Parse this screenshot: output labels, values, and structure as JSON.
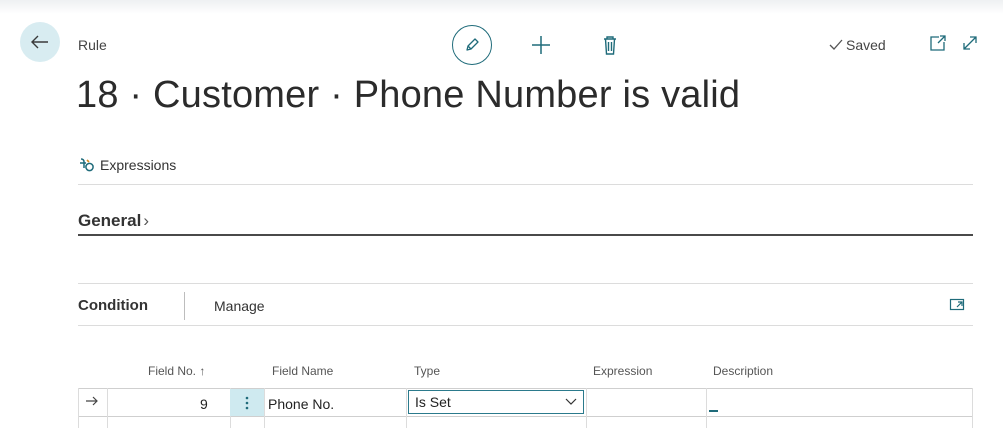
{
  "header": {
    "caption": "Rule",
    "saved_label": "Saved",
    "title": "18 · Customer · Phone Number is valid"
  },
  "actions": {
    "expressions_label": "Expressions"
  },
  "general": {
    "label": "General",
    "chevron": "›"
  },
  "condition": {
    "title": "Condition",
    "manage_label": "Manage",
    "columns": {
      "field_no": "Field No. ↑",
      "field_name": "Field Name",
      "type": "Type",
      "expression": "Expression",
      "description": "Description"
    },
    "rows": [
      {
        "field_no": "9",
        "field_name": "Phone No.",
        "type": "Is Set",
        "expression": "",
        "description": ""
      }
    ]
  },
  "colors": {
    "accent": "#1f6b7a",
    "back_button_bg": "#d8ecf1",
    "row_highlight": "#cfeaf0"
  },
  "icons": [
    "back-arrow-icon",
    "pencil-icon",
    "plus-icon",
    "trash-icon",
    "checkmark-icon",
    "open-in-new-window-icon",
    "expand-icon",
    "expressions-icon",
    "collapse-expand-icon",
    "row-arrow-icon",
    "more-dots-icon",
    "chevron-down-icon"
  ]
}
